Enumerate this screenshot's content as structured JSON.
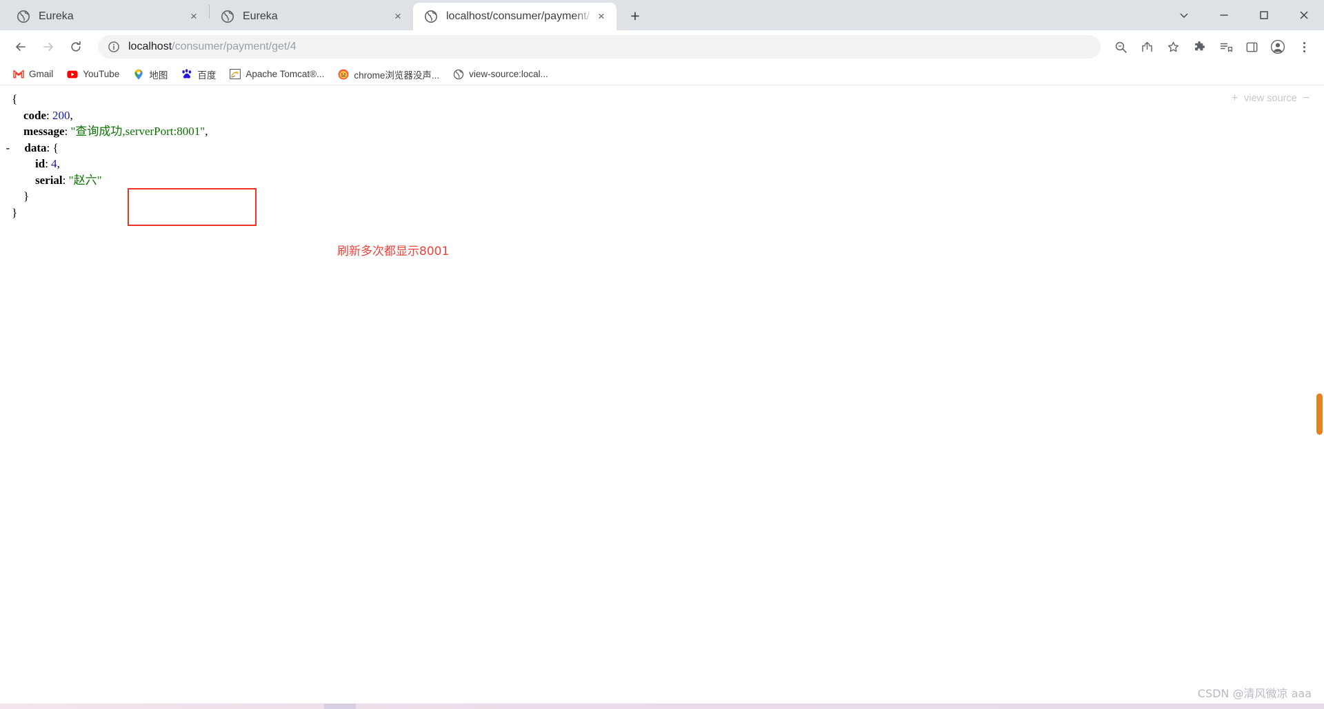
{
  "window": {
    "controls": {
      "more_label": "chevron-down",
      "minimize_label": "minimize",
      "maximize_label": "maximize",
      "close_label": "close"
    }
  },
  "tabs": [
    {
      "title": "Eureka",
      "favicon": "globe-icon",
      "close_label": "×",
      "active": false
    },
    {
      "title": "Eureka",
      "favicon": "globe-icon",
      "close_label": "×",
      "active": false
    },
    {
      "title": "localhost/consumer/payment/",
      "favicon": "globe-icon",
      "close_label": "×",
      "active": true
    }
  ],
  "newtab": {
    "label": "+"
  },
  "toolbar": {
    "back_label": "←",
    "forward_label": "→",
    "reload_label": "⟳",
    "site_info_label": "site-info",
    "url_host": "localhost",
    "url_path": "/consumer/payment/get/4",
    "url_full": "localhost/consumer/payment/get/4",
    "zoom_label": "zoom-icon",
    "share_label": "share-icon",
    "bookmark_label": "star-icon",
    "extensions_label": "extensions-icon",
    "readinglist_label": "reading-list-icon",
    "sidepanel_label": "side-panel-icon",
    "profile_label": "profile-icon",
    "menu_label": "⋮"
  },
  "bookmarks": [
    {
      "label": "Gmail",
      "icon": "gmail-icon"
    },
    {
      "label": "YouTube",
      "icon": "youtube-icon"
    },
    {
      "label": "地图",
      "icon": "maps-icon"
    },
    {
      "label": "百度",
      "icon": "baidu-icon"
    },
    {
      "label": "Apache Tomcat®...",
      "icon": "tomcat-icon"
    },
    {
      "label": "chrome浏览器没声...",
      "icon": "csdn-icon"
    },
    {
      "label": "view-source:local...",
      "icon": "globe-icon"
    }
  ],
  "json_viewer": {
    "view_source": {
      "plus": "+",
      "label": "view source",
      "minus": "−"
    },
    "lines": [
      {
        "indent": 0,
        "toggle": "",
        "key": "",
        "sep": "",
        "value": "{",
        "value_type": "punct",
        "trailing": ""
      },
      {
        "indent": 1,
        "toggle": "",
        "key": "code",
        "sep": ":",
        "value": "200",
        "value_type": "num",
        "trailing": ","
      },
      {
        "indent": 1,
        "toggle": "",
        "key": "message",
        "sep": ":",
        "value": "\"查询成功,serverPort:8001\"",
        "value_type": "str",
        "trailing": ","
      },
      {
        "indent": 1,
        "toggle": "-",
        "key": "data",
        "sep": ":",
        "value": "{",
        "value_type": "punct",
        "trailing": ""
      },
      {
        "indent": 2,
        "toggle": "",
        "key": "id",
        "sep": ":",
        "value": "4",
        "value_type": "num",
        "trailing": ","
      },
      {
        "indent": 2,
        "toggle": "",
        "key": "serial",
        "sep": ":",
        "value": "\"赵六\"",
        "value_type": "str",
        "trailing": ""
      },
      {
        "indent": 1,
        "toggle": "",
        "key": "",
        "sep": "",
        "value": "}",
        "value_type": "punct",
        "trailing": ""
      },
      {
        "indent": 0,
        "toggle": "",
        "key": "",
        "sep": "",
        "value": "}",
        "value_type": "punct",
        "trailing": ""
      }
    ]
  },
  "annotations": {
    "highlight_box_color": "#ee3224",
    "note_text": "刷新多次都显示8001",
    "note_color": "#f2413b"
  },
  "watermark": {
    "text": "CSDN @清风微凉 aaa"
  }
}
